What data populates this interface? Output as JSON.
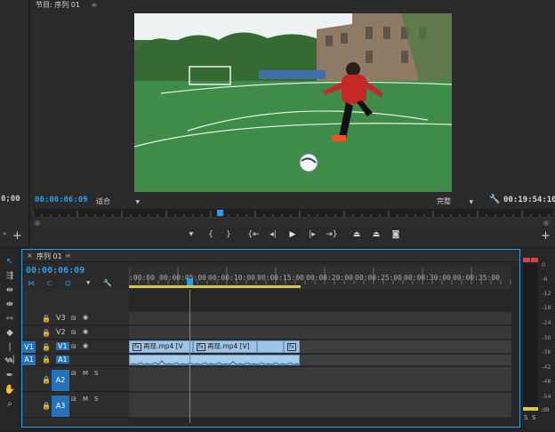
{
  "program_monitor": {
    "title": "节目: 序列 01",
    "current_time": "00:00:06:09",
    "fit_label": "适合",
    "quality_label": "完整",
    "duration": "00:19:54:10",
    "left_panel_time": "0;00"
  },
  "transport": {
    "buttons": [
      "add-marker",
      "mark-in",
      "mark-out",
      "go-to-in",
      "step-back",
      "play",
      "step-forward",
      "go-to-out",
      "lift",
      "extract",
      "export-frame"
    ]
  },
  "timeline": {
    "tab_close": "×",
    "title": "序列 01",
    "current_time": "00:00:06:09",
    "ruler_labels": [
      ":00:00",
      "00:00:05:00",
      "00:00:10:00",
      "00:00:15:00",
      "00:00:20:00",
      "00:00:25:00",
      "00:00:30:00",
      "00:00:35:00"
    ],
    "tracks": {
      "v3": "V3",
      "v2": "V2",
      "v1": "V1",
      "v1_source": "V1",
      "a1": "A1",
      "a1_source": "A1",
      "a2": "A2",
      "a3": "A3",
      "mute": "M",
      "solo": "S"
    },
    "clips": {
      "video_clip_1": "再现.mp4 [V",
      "video_clip_2": "再现.mp4 [V]"
    }
  },
  "audio_meter": {
    "labels": [
      "0",
      "-6",
      "-12",
      "-18",
      "-24",
      "-30",
      "-36",
      "-42",
      "-48",
      "-54",
      "dB"
    ],
    "footer_left": "S",
    "footer_right": "S"
  },
  "colors": {
    "accent": "#2e9ce6",
    "clip": "#9fc3e5",
    "track_selected": "#2572b8"
  }
}
